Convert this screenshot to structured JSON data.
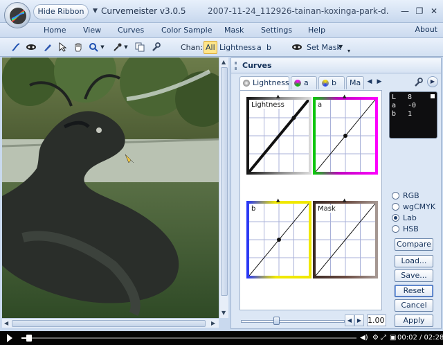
{
  "app": {
    "hide_ribbon_label": "Hide Ribbon",
    "title": "Curvemeister v3.0.5",
    "file_title": "2007-11-24_112926-tainan-koxinga-park-d...",
    "minimize": "—",
    "restore": "❐",
    "close": "✕"
  },
  "menu": {
    "items": [
      "Home",
      "View",
      "Curves",
      "Color Sample",
      "Mask",
      "Settings",
      "Help"
    ],
    "about": "About"
  },
  "toolbar": {
    "chan_label": "Chan:",
    "channels": [
      "All",
      "Lightness",
      "a",
      "b"
    ],
    "active_channel": "All",
    "set_mask_label": "Set Mask"
  },
  "panel": {
    "title": "Curves",
    "tabs": [
      "Lightness",
      "a",
      "b",
      "Ma"
    ],
    "curves": [
      {
        "label": "Lightness",
        "color": "#111111"
      },
      {
        "label": "a",
        "color": "#ff00ff"
      },
      {
        "label": "b",
        "color": "#f0e800"
      },
      {
        "label": "Mask",
        "color": "#5a3a30"
      }
    ],
    "readout": {
      "rows": [
        {
          "label": "L",
          "value": "8"
        },
        {
          "label": "a",
          "value": "-0"
        },
        {
          "label": "b",
          "value": "1"
        }
      ]
    },
    "color_modes": [
      "RGB",
      "wgCMYK",
      "Lab",
      "HSB"
    ],
    "selected_mode": "Lab",
    "buttons": {
      "compare": "Compare",
      "load": "Load...",
      "save": "Save...",
      "reset": "Reset",
      "cancel": "Cancel",
      "apply": "Apply"
    },
    "zoom_value": "1.00"
  },
  "player": {
    "time": "00:02 / 02:28",
    "progress": 0.014
  },
  "colors": {
    "accent": "#15325a",
    "active_channel_bg": "#ffe58a"
  }
}
